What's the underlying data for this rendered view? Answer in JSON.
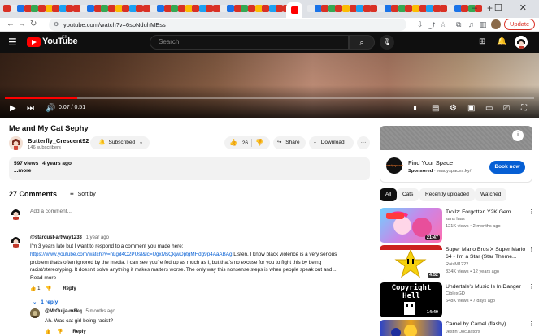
{
  "browser": {
    "url": "youtube.com/watch?v=6spNduhMEss",
    "update_label": "Update",
    "new_tab_symbol": "+",
    "window_controls": "– ☐ ✕"
  },
  "header": {
    "logo_text": "YouTube",
    "region": "GB",
    "search_placeholder": "Search"
  },
  "player": {
    "current_time": "0:07",
    "duration": "0:51",
    "time_separator": " / ",
    "progress_fraction": 0.137
  },
  "video": {
    "title": "Me and My Cat Sephy",
    "channel_name": "Butterfly_Crescent92",
    "subscribers": "146 subscribers",
    "subscribe_label": "Subscribed",
    "likes": "26",
    "share_label": "Share",
    "download_label": "Download",
    "views": "597 views",
    "age": "4 years ago",
    "more_label": "...more"
  },
  "comments": {
    "count_label": "27 Comments",
    "sort_label": "Sort by",
    "add_placeholder": "Add a comment...",
    "items": [
      {
        "handle": "@stardust-artway1233",
        "time": "1 year ago",
        "line1": "I'm 3 years late but I want to respond to a comment you made here:",
        "link": "https://www.youtube.com/watch?v=hLgd4O2PUsI&lc=UgxMsQkjwDptgMHdg9p4AaABAg",
        "line2_tail": " Listen, I know black violence is a very serious",
        "line3": "problem that's often ignored by the media. I can see you're fed up as much as I, but that's no excuse for you to fight this by being",
        "line4": "racist/stereotyping. It doesn't solve anything it makes matters worse. The only way this nonsense steps is when people speak out and ...",
        "read_more": "Read more",
        "likes": "1",
        "reply_label": "Reply",
        "replies_label": "1 reply"
      },
      {
        "handle": "@MrGuija-m8kq",
        "time": "5 months ago",
        "text": "Ah. Was cat girl being racist?",
        "reply_label": "Reply"
      }
    ]
  },
  "ad": {
    "title": "Find Your Space",
    "sponsored_label": "Sponsored",
    "domain": "readyspaces.ky/",
    "button_label": "Book now",
    "logo_text": "readyspaces"
  },
  "filters": [
    "All",
    "Cats",
    "Recently uploaded",
    "Watched"
  ],
  "related": [
    {
      "title": "Trollz: Forgotten Y2K Gem",
      "channel": "sans luas",
      "meta": "121K views • 2 months ago",
      "duration": "21:47"
    },
    {
      "title": "Super Mario Bros X Super Mario 64 - I'm a Star (Star Theme...",
      "channel": "RaisM1222",
      "meta": "334K views • 12 years ago",
      "duration": "4:52"
    },
    {
      "title": "Undertale's Music Is In Danger",
      "channel": "CiblexGD",
      "meta": "648K views • 7 days ago",
      "duration": "14:40",
      "thumb_text": "Copyright Hell"
    },
    {
      "title": "Camel by Camel (flashy)",
      "channel": "Jestin' Joculators",
      "meta": "",
      "duration": ""
    }
  ],
  "colors": {
    "accent": "#ff0000",
    "link": "#065fd4",
    "header_bg": "#0f0f0f",
    "tab_strip": "#dee1e6"
  }
}
